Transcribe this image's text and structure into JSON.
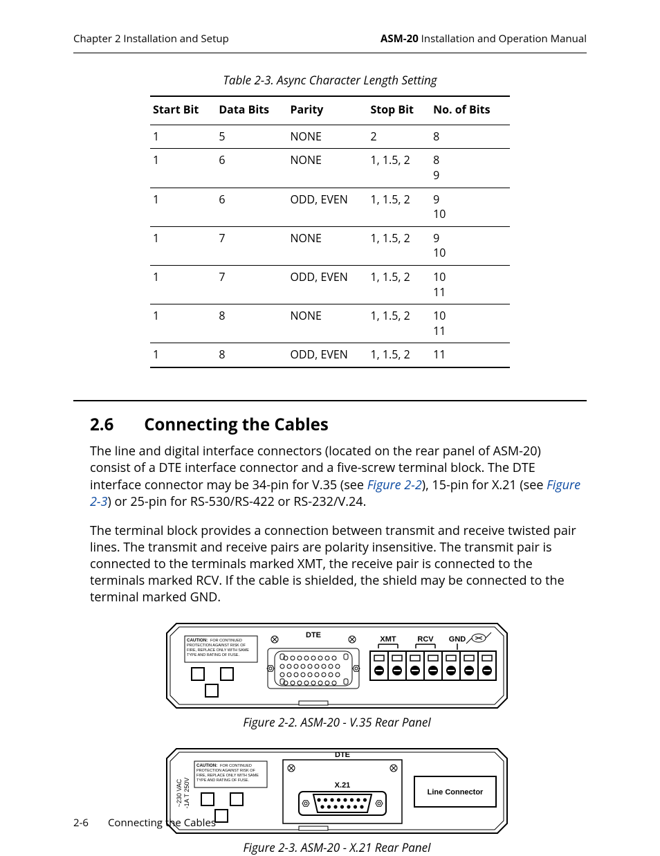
{
  "header": {
    "left": "Chapter 2  Installation and Setup",
    "right_strong": "ASM-20",
    "right_rest": " Installation and Operation Manual"
  },
  "table": {
    "caption": "Table 2-3.  Async Character Length Setting",
    "columns": [
      "Start Bit",
      "Data Bits",
      "Parity",
      "Stop Bit",
      "No. of Bits"
    ],
    "rows": [
      {
        "start": "1",
        "data": "5",
        "parity": "NONE",
        "stop": "2",
        "bits": [
          "8"
        ]
      },
      {
        "start": "1",
        "data": "6",
        "parity": "NONE",
        "stop": "1, 1.5, 2",
        "bits": [
          "8",
          "9"
        ]
      },
      {
        "start": "1",
        "data": "6",
        "parity": "ODD, EVEN",
        "stop": "1, 1.5, 2",
        "bits": [
          "9",
          "10"
        ]
      },
      {
        "start": "1",
        "data": "7",
        "parity": "NONE",
        "stop": "1, 1.5, 2",
        "bits": [
          "9",
          "10"
        ]
      },
      {
        "start": "1",
        "data": "7",
        "parity": "ODD, EVEN",
        "stop": "1, 1.5, 2",
        "bits": [
          "10",
          "11"
        ]
      },
      {
        "start": "1",
        "data": "8",
        "parity": "NONE",
        "stop": "1, 1.5, 2",
        "bits": [
          "10",
          "11"
        ]
      },
      {
        "start": "1",
        "data": "8",
        "parity": "ODD, EVEN",
        "stop": "1, 1.5, 2",
        "bits": [
          "11"
        ]
      }
    ]
  },
  "section": {
    "number": "2.6",
    "title": "Connecting the Cables",
    "para1_a": "The line and digital interface connectors (located on the rear panel of ASM-20) consist of a DTE interface connector and a five-screw terminal block. The DTE interface connector may be 34-pin for V.35 (see ",
    "xref1": "Figure 2-2",
    "para1_b": "), 15-pin for X.21 (see ",
    "xref2": "Figure 2-3",
    "para1_c": ") or 25-pin for RS-530/RS-422 or RS-232/V.24.",
    "para2": "The terminal block provides a connection between transmit and receive twisted pair lines. The transmit and receive pairs are polarity insensitive. The transmit pair is connected to the terminals marked XMT, the receive pair is connected to the terminals marked RCV. If the cable is shielded, the shield may be connected to the terminal marked GND."
  },
  "figures": {
    "f1": {
      "caption": "Figure 2-2.  ASM-20 - V.35 Rear Panel",
      "labels": {
        "dte": "DTE",
        "xmt": "XMT",
        "rcv": "RCV",
        "gnd": "GND",
        "caution_heading": "CAUTION:",
        "caution_body": "FOR CONTINUED PROTECTION AGAINST RISK OF FIRE, REPLACE ONLY WITH SAME TYPE AND RATING OF FUSE."
      }
    },
    "f2": {
      "caption": "Figure 2-3.  ASM-20 - X.21 Rear Panel",
      "labels": {
        "dte": "DTE",
        "x21": "X.21",
        "line_connector": "Line Connector",
        "vac_line1": "~230  VAC",
        "vac_line2": "-1A  T  250V",
        "caution_heading": "CAUTION:",
        "caution_body": "FOR CONTINUED PROTECTION AGAINST RISK OF FIRE, REPLACE ONLY WITH SAME TYPE AND RATING OF FUSE."
      }
    }
  },
  "footer": {
    "page": "2-6",
    "title": "Connecting the Cables"
  }
}
